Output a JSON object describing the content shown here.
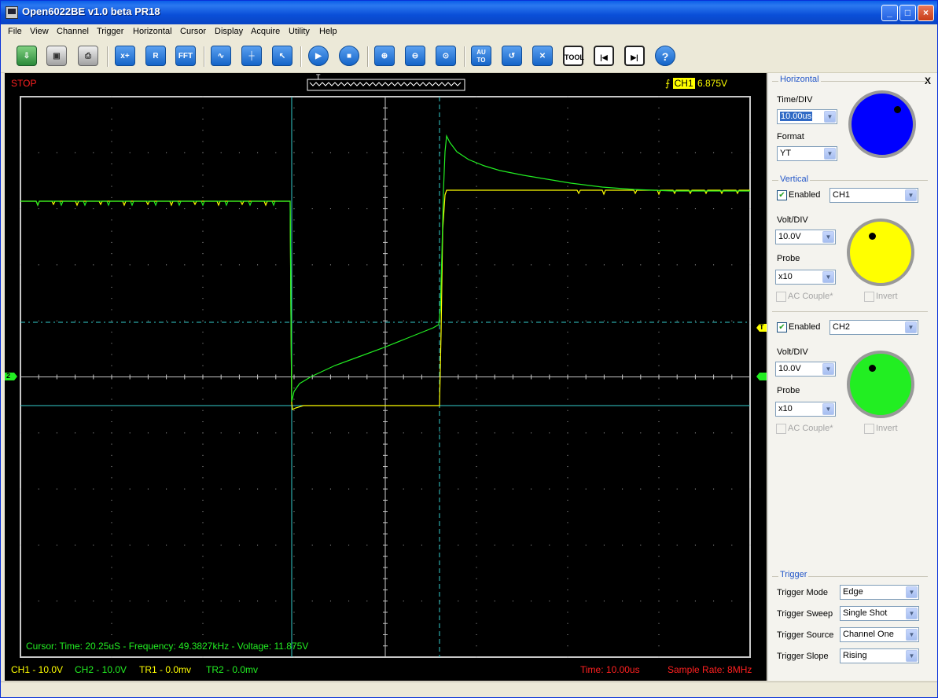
{
  "window": {
    "title": "Open6022BE v1.0 beta PR18"
  },
  "menu": [
    "File",
    "View",
    "Channel",
    "Trigger",
    "Horizontal",
    "Cursor",
    "Display",
    "Acquire",
    "Utility",
    "Help"
  ],
  "toolbar": {
    "icons": [
      "save-export-icon",
      "save-icon",
      "print-icon",
      "math-icon",
      "reference-icon",
      "fft-icon",
      "sine-wave-icon",
      "cursor-crosshair-icon",
      "pointer-icon",
      "run-icon",
      "stop-icon",
      "zoom-in-icon",
      "zoom-out-icon",
      "zoom-fit-icon",
      "auto-icon",
      "refresh-icon",
      "fullscreen-icon",
      "tool-icon",
      "step-back-icon",
      "step-forward-icon",
      "help-icon"
    ],
    "labels": {
      "math": "x+",
      "reference": "R",
      "fft": "FFT",
      "auto": "AU TO",
      "tool": "TOOL",
      "help": "?"
    }
  },
  "scope": {
    "state": "STOP",
    "trigger_marker": "T",
    "trigger_channel": "CH1",
    "trigger_level": "6.875V",
    "ch2_marker": "2",
    "trigger_level_marker": "T",
    "cursor_readout": "Cursor: Time: 20.25uS - Frequency: 49.3827kHz - Voltage: 11.875V",
    "status": {
      "ch1": "CH1 - 10.0V",
      "ch2": "CH2 - 10.0V",
      "tr1": "TR1 - 0.0mv",
      "tr2": "TR2 - 0.0mv",
      "time": "Time: 10.00us",
      "sample_rate": "Sample Rate: 8MHz"
    },
    "colors": {
      "ch1": "#ffff00",
      "ch2": "#22ee22",
      "cursor": "#33cccc",
      "grid": "#c8c8c8",
      "red": "#ff2020"
    }
  },
  "panel": {
    "close": "X",
    "horizontal": {
      "title": "Horizontal",
      "time_div_label": "Time/DIV",
      "time_div_value": "10.00us",
      "format_label": "Format",
      "format_value": "YT",
      "knob_color": "#0000ff"
    },
    "vertical": {
      "title": "Vertical",
      "ch1": {
        "enabled_label": "Enabled",
        "channel": "CH1",
        "volt_div_label": "Volt/DIV",
        "volt_div": "10.0V",
        "probe_label": "Probe",
        "probe": "x10",
        "ac_couple": "AC Couple*",
        "invert": "Invert",
        "knob_color": "#ffff00"
      },
      "ch2": {
        "enabled_label": "Enabled",
        "channel": "CH2",
        "volt_div_label": "Volt/DIV",
        "volt_div": "10.0V",
        "probe_label": "Probe",
        "probe": "x10",
        "ac_couple": "AC Couple*",
        "invert": "Invert",
        "knob_color": "#22ee22"
      }
    },
    "trigger": {
      "title": "Trigger",
      "mode_label": "Trigger Mode",
      "mode": "Edge",
      "sweep_label": "Trigger Sweep",
      "sweep": "Single Shot",
      "source_label": "Trigger Source",
      "source": "Channel One",
      "slope_label": "Trigger Slope",
      "slope": "Rising"
    }
  }
}
